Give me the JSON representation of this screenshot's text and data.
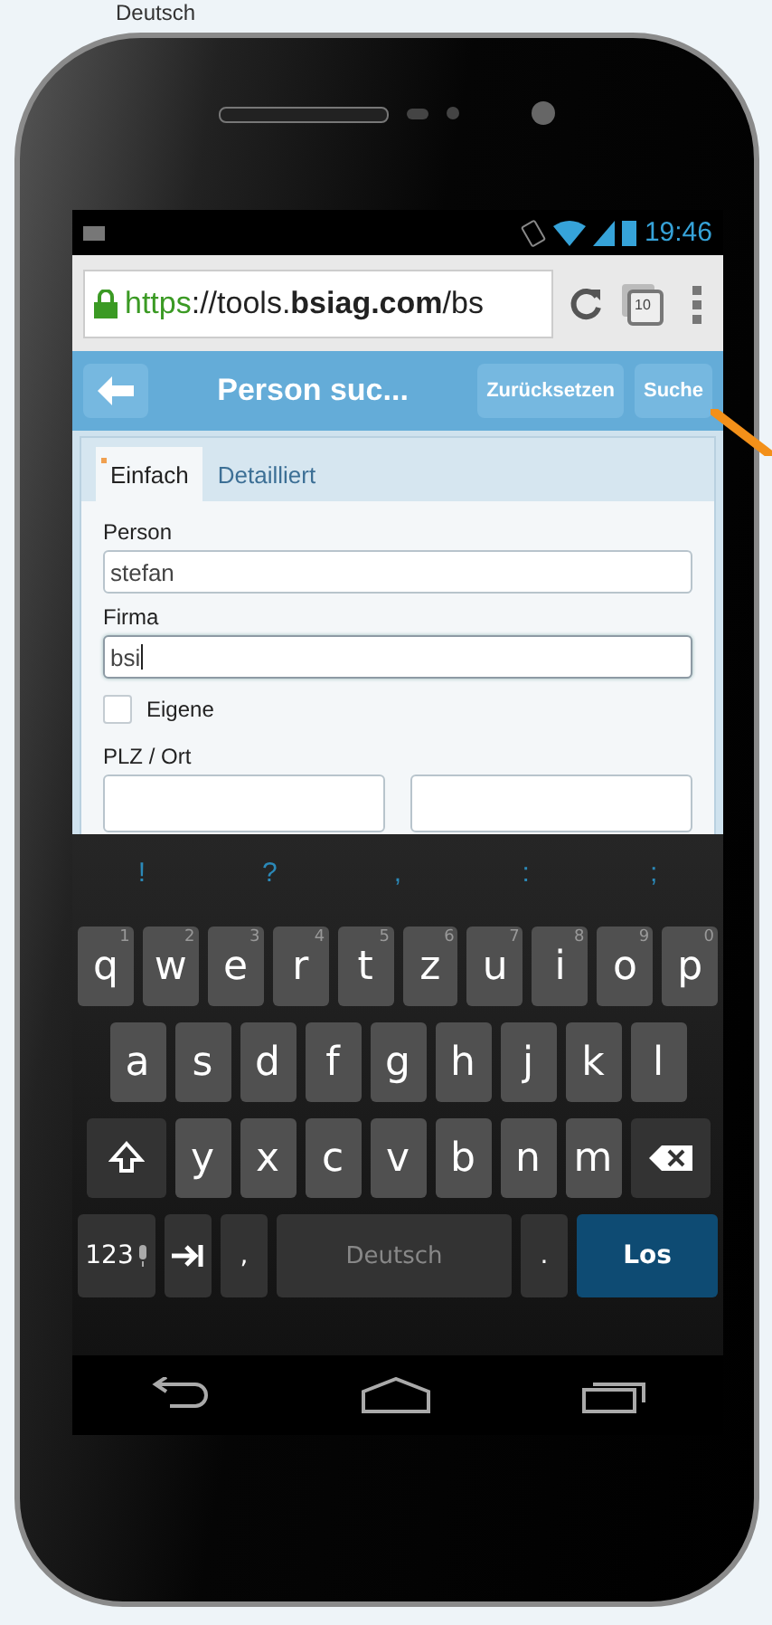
{
  "background_text": "Deutsch",
  "status_bar": {
    "time": "19:46"
  },
  "browser": {
    "url_scheme": "https",
    "url_rest": "://tools.",
    "url_domain": "bsiag.com",
    "url_path": "/bs",
    "tab_count": "10"
  },
  "header": {
    "title": "Person suc...",
    "buttons": [
      "Zurücksetzen",
      "Suche"
    ]
  },
  "form": {
    "tabs": [
      {
        "label": "Einfach",
        "selected": true,
        "changed": true
      },
      {
        "label": "Detailliert",
        "selected": false,
        "changed": false
      }
    ],
    "fields": [
      {
        "kind": "text",
        "label": "Person",
        "value": "stefan",
        "focused": false
      },
      {
        "kind": "text",
        "label": "Firma",
        "value": "bsi",
        "focused": true
      },
      {
        "kind": "checkbox",
        "label": "Eigene",
        "checked": false
      },
      {
        "kind": "pair",
        "label": "PLZ / Ort"
      }
    ]
  },
  "keyboard": {
    "suggestions": [
      "!",
      "?",
      ",",
      ":",
      ";"
    ],
    "rows": [
      {
        "keys": [
          {
            "kind": "letter",
            "label": "q",
            "hint": "1"
          },
          {
            "kind": "letter",
            "label": "w",
            "hint": "2"
          },
          {
            "kind": "letter",
            "label": "e",
            "hint": "3"
          },
          {
            "kind": "letter",
            "label": "r",
            "hint": "4"
          },
          {
            "kind": "letter",
            "label": "t",
            "hint": "5"
          },
          {
            "kind": "letter",
            "label": "z",
            "hint": "6"
          },
          {
            "kind": "letter",
            "label": "u",
            "hint": "7"
          },
          {
            "kind": "letter",
            "label": "i",
            "hint": "8"
          },
          {
            "kind": "letter",
            "label": "o",
            "hint": "9"
          },
          {
            "kind": "letter",
            "label": "p",
            "hint": "0"
          }
        ]
      },
      {
        "keys": [
          {
            "kind": "letter",
            "label": "a"
          },
          {
            "kind": "letter",
            "label": "s"
          },
          {
            "kind": "letter",
            "label": "d"
          },
          {
            "kind": "letter",
            "label": "f"
          },
          {
            "kind": "letter",
            "label": "g"
          },
          {
            "kind": "letter",
            "label": "h"
          },
          {
            "kind": "letter",
            "label": "j"
          },
          {
            "kind": "letter",
            "label": "k"
          },
          {
            "kind": "letter",
            "label": "l"
          }
        ]
      },
      {
        "keys": [
          {
            "kind": "shift"
          },
          {
            "kind": "letter",
            "label": "y"
          },
          {
            "kind": "letter",
            "label": "x"
          },
          {
            "kind": "letter",
            "label": "c"
          },
          {
            "kind": "letter",
            "label": "v"
          },
          {
            "kind": "letter",
            "label": "b"
          },
          {
            "kind": "letter",
            "label": "n"
          },
          {
            "kind": "letter",
            "label": "m"
          },
          {
            "kind": "backspace"
          }
        ]
      },
      {
        "keys": [
          {
            "kind": "symbols",
            "label": "123"
          },
          {
            "kind": "tab"
          },
          {
            "kind": "punct",
            "label": ","
          },
          {
            "kind": "space",
            "label": "Deutsch"
          },
          {
            "kind": "punct",
            "label": "."
          },
          {
            "kind": "action",
            "label": "Los"
          }
        ]
      }
    ]
  }
}
